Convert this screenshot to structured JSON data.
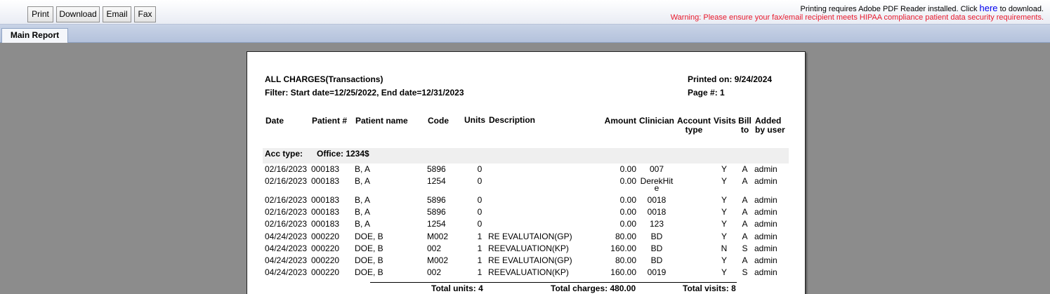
{
  "toolbar": {
    "print": "Print",
    "download": "Download",
    "email": "Email",
    "fax": "Fax",
    "notice_prefix": "Printing requires Adobe PDF Reader installed. Click",
    "notice_link": "here",
    "notice_suffix": "to download.",
    "warning": "Warning: Please ensure your fax/email recipient meets HIPAA compliance patient data security requirements."
  },
  "tabs": {
    "main": "Main Report"
  },
  "report": {
    "title": "ALL CHARGES(Transactions)",
    "filter": "Filter: Start date=12/25/2022, End date=12/31/2023",
    "printed_on": "Printed on: 9/24/2024",
    "page": "Page #: 1",
    "columns": {
      "date": "Date",
      "patient_no": "Patient #",
      "patient_name": "Patient name",
      "code": "Code",
      "units": "Units",
      "description": "Description",
      "amount": "Amount",
      "clinician": "Clinician",
      "account_type_1": "Account",
      "account_type_2": "type",
      "visits": "Visits",
      "bill_to_1": "Bill",
      "bill_to_2": "to",
      "added_by_1": "Added",
      "added_by_2": "by user"
    },
    "group_label": "Acc type:",
    "group_value": "Office: 1234$",
    "rows": [
      {
        "date": "02/16/2023",
        "patient_no": "000183",
        "name": "B, A",
        "code": "5896",
        "units": "0",
        "desc": "",
        "amount": "0.00",
        "clinician": "007",
        "clinician_2": "",
        "acct": "",
        "visits": "Y",
        "bill": "A",
        "user": "admin"
      },
      {
        "date": "02/16/2023",
        "patient_no": "000183",
        "name": "B, A",
        "code": "1254",
        "units": "0",
        "desc": "",
        "amount": "0.00",
        "clinician": "DerekHit",
        "clinician_2": "e",
        "acct": "",
        "visits": "Y",
        "bill": "A",
        "user": "admin"
      },
      {
        "date": "02/16/2023",
        "patient_no": "000183",
        "name": "B, A",
        "code": "5896",
        "units": "0",
        "desc": "",
        "amount": "0.00",
        "clinician": "0018",
        "clinician_2": "",
        "acct": "",
        "visits": "Y",
        "bill": "A",
        "user": "admin"
      },
      {
        "date": "02/16/2023",
        "patient_no": "000183",
        "name": "B, A",
        "code": "5896",
        "units": "0",
        "desc": "",
        "amount": "0.00",
        "clinician": "0018",
        "clinician_2": "",
        "acct": "",
        "visits": "Y",
        "bill": "A",
        "user": "admin"
      },
      {
        "date": "02/16/2023",
        "patient_no": "000183",
        "name": "B, A",
        "code": "1254",
        "units": "0",
        "desc": "",
        "amount": "0.00",
        "clinician": "123",
        "clinician_2": "",
        "acct": "",
        "visits": "Y",
        "bill": "A",
        "user": "admin"
      },
      {
        "date": "04/24/2023",
        "patient_no": "000220",
        "name": "DOE, B",
        "code": "M002",
        "units": "1",
        "desc": "RE EVALUTAION(GP)",
        "amount": "80.00",
        "clinician": "BD",
        "clinician_2": "",
        "acct": "",
        "visits": "Y",
        "bill": "A",
        "user": "admin"
      },
      {
        "date": "04/24/2023",
        "patient_no": "000220",
        "name": "DOE, B",
        "code": "002",
        "units": "1",
        "desc": "REEVALUATION(KP)",
        "amount": "160.00",
        "clinician": "BD",
        "clinician_2": "",
        "acct": "",
        "visits": "N",
        "bill": "S",
        "user": "admin"
      },
      {
        "date": "04/24/2023",
        "patient_no": "000220",
        "name": "DOE, B",
        "code": "M002",
        "units": "1",
        "desc": "RE EVALUTAION(GP)",
        "amount": "80.00",
        "clinician": "BD",
        "clinician_2": "",
        "acct": "",
        "visits": "Y",
        "bill": "A",
        "user": "admin"
      },
      {
        "date": "04/24/2023",
        "patient_no": "000220",
        "name": "DOE, B",
        "code": "002",
        "units": "1",
        "desc": "REEVALUATION(KP)",
        "amount": "160.00",
        "clinician": "0019",
        "clinician_2": "",
        "acct": "",
        "visits": "Y",
        "bill": "S",
        "user": "admin"
      }
    ],
    "totals": {
      "units": "Total units: 4",
      "charges": "Total charges: 480.00",
      "visits": "Total visits: 8"
    }
  }
}
